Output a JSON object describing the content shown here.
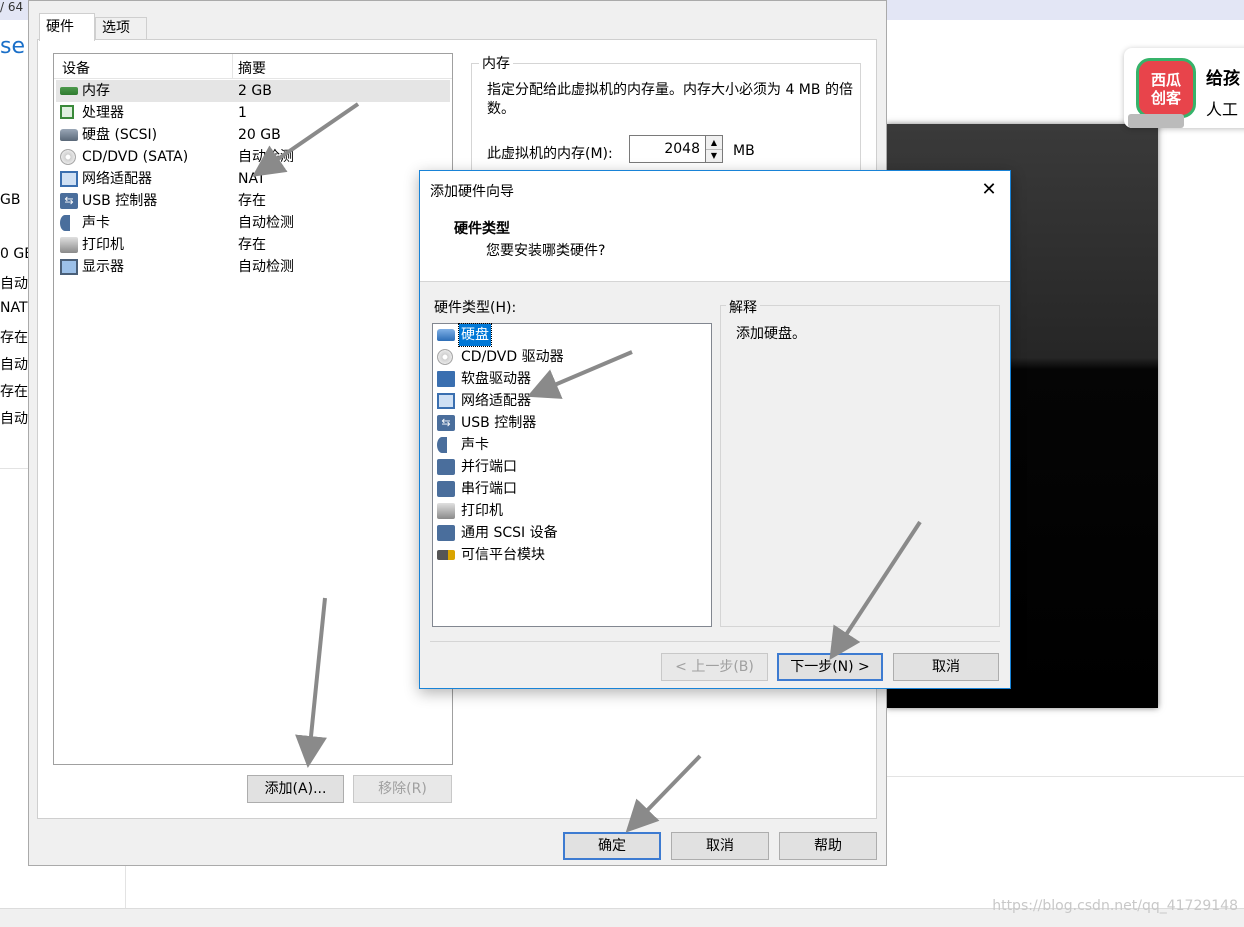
{
  "background": {
    "topbar_text": "/ 64",
    "left_title": "se",
    "left_column": [
      "GB",
      "0 GE",
      "自动检",
      "NAT",
      "存在",
      "自动检",
      "存在",
      "自动检"
    ],
    "promo": {
      "logo_text": "西瓜\n创客",
      "line1": "给孩",
      "line2": "人工"
    },
    "watermark": "https://blog.csdn.net/qq_41729148"
  },
  "settings": {
    "tabs": [
      {
        "label": "硬件"
      },
      {
        "label": "选项"
      }
    ],
    "device_list": {
      "headers": {
        "device": "设备",
        "summary": "摘要"
      },
      "rows": [
        {
          "name": "内存",
          "summary": "2 GB",
          "icon": "memory-icon"
        },
        {
          "name": "处理器",
          "summary": "1",
          "icon": "processor-icon"
        },
        {
          "name": "硬盘 (SCSI)",
          "summary": "20 GB",
          "icon": "harddisk-icon"
        },
        {
          "name": "CD/DVD (SATA)",
          "summary": "自动检测",
          "icon": "cd-dvd-icon"
        },
        {
          "name": "网络适配器",
          "summary": "NAT",
          "icon": "network-adapter-icon"
        },
        {
          "name": "USB 控制器",
          "summary": "存在",
          "icon": "usb-icon"
        },
        {
          "name": "声卡",
          "summary": "自动检测",
          "icon": "sound-card-icon"
        },
        {
          "name": "打印机",
          "summary": "存在",
          "icon": "printer-icon"
        },
        {
          "name": "显示器",
          "summary": "自动检测",
          "icon": "display-icon"
        }
      ]
    },
    "add_button": "添加(A)...",
    "remove_button": "移除(R)",
    "memory": {
      "group_title": "内存",
      "description": "指定分配给此虚拟机的内存量。内存大小必须为 4 MB 的倍数。",
      "field_label": "此虚拟机的内存(M):",
      "value": "2048",
      "unit": "MB"
    },
    "ok_button": "确定",
    "cancel_button": "取消",
    "help_button": "帮助"
  },
  "wizard": {
    "title": "添加硬件向导",
    "close_glyph": "✕",
    "header_title": "硬件类型",
    "header_subtitle": "您要安装哪类硬件?",
    "list_label": "硬件类型(H):",
    "hardware_types": [
      {
        "name": "硬盘",
        "icon": "harddisk-icon",
        "selected": true
      },
      {
        "name": "CD/DVD 驱动器",
        "icon": "cd-dvd-icon"
      },
      {
        "name": "软盘驱动器",
        "icon": "floppy-icon"
      },
      {
        "name": "网络适配器",
        "icon": "network-adapter-icon"
      },
      {
        "name": "USB 控制器",
        "icon": "usb-icon"
      },
      {
        "name": "声卡",
        "icon": "sound-card-icon"
      },
      {
        "name": "并行端口",
        "icon": "parallel-port-icon"
      },
      {
        "name": "串行端口",
        "icon": "serial-port-icon"
      },
      {
        "name": "打印机",
        "icon": "printer-icon"
      },
      {
        "name": "通用 SCSI 设备",
        "icon": "scsi-icon"
      },
      {
        "name": "可信平台模块",
        "icon": "tpm-icon"
      }
    ],
    "explanation_title": "解释",
    "explanation_text": "添加硬盘。",
    "back_button": "< 上一步(B)",
    "next_button": "下一步(N) >",
    "cancel_button": "取消"
  },
  "colors": {
    "selection": "#0078d7",
    "dialog_border": "#1883d7",
    "default_button_border": "#3d7bd1",
    "arrow": "#8a8a8a"
  }
}
